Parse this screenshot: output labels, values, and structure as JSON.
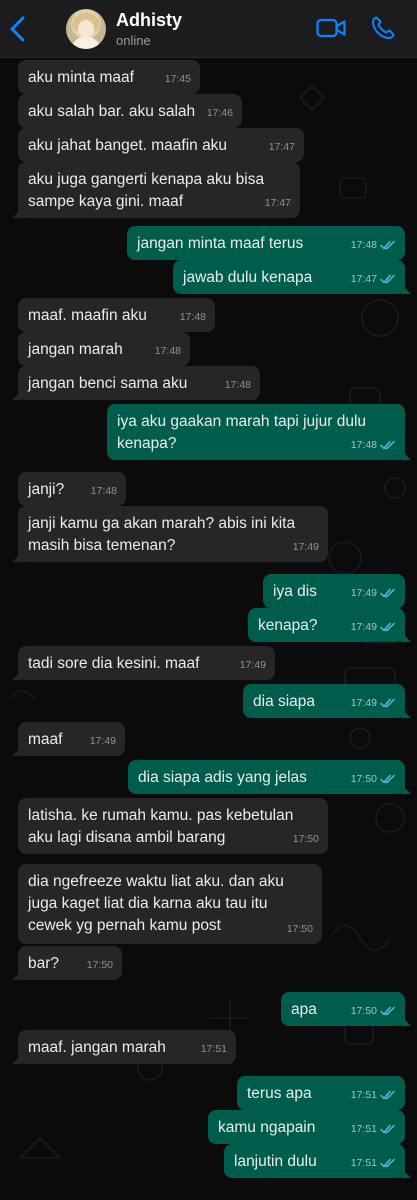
{
  "header": {
    "contact_name": "Adhisty",
    "status": "online"
  },
  "icons": {
    "back": "chevron-left-icon",
    "video": "video-call-icon",
    "call": "phone-icon",
    "read": "double-check-icon"
  },
  "colors": {
    "accent": "#0a84ff",
    "incoming_bubble": "#262628",
    "outgoing_bubble": "#005c4b",
    "read_ticks": "#53bdeb"
  },
  "messages": [
    {
      "dir": "in",
      "text": "aku minta maaf",
      "time": "17:45"
    },
    {
      "dir": "in",
      "text": "aku salah bar. aku salah",
      "time": "17:46"
    },
    {
      "dir": "in",
      "text": "aku jahat banget. maafin aku",
      "time": "17:47"
    },
    {
      "dir": "in",
      "text": "aku juga gangerti kenapa aku bisa\nsampe kaya gini. maaf",
      "time": "17:47"
    },
    {
      "dir": "out",
      "text": "jangan minta maaf terus",
      "time": "17:48",
      "read": true
    },
    {
      "dir": "out",
      "text": "jawab dulu kenapa",
      "time": "17:47",
      "read": true
    },
    {
      "dir": "in",
      "text": "maaf. maafin aku",
      "time": "17:48"
    },
    {
      "dir": "in",
      "text": "jangan marah",
      "time": "17:48"
    },
    {
      "dir": "in",
      "text": "jangan benci sama aku",
      "time": "17:48"
    },
    {
      "dir": "out",
      "text": "iya aku gaakan marah tapi jujur dulu\nkenapa?",
      "time": "17:48",
      "read": true
    },
    {
      "dir": "in",
      "text": "janji?",
      "time": "17:48"
    },
    {
      "dir": "in",
      "text": "janji kamu ga akan marah? abis ini kita\nmasih bisa temenan?",
      "time": "17:49"
    },
    {
      "dir": "out",
      "text": "iya dis",
      "time": "17:49",
      "read": true
    },
    {
      "dir": "out",
      "text": "kenapa?",
      "time": "17:49",
      "read": true
    },
    {
      "dir": "in",
      "text": "tadi sore dia kesini. maaf",
      "time": "17:49"
    },
    {
      "dir": "out",
      "text": "dia siapa",
      "time": "17:49",
      "read": true
    },
    {
      "dir": "in",
      "text": "maaf",
      "time": "17:49"
    },
    {
      "dir": "out",
      "text": "dia siapa adis yang jelas",
      "time": "17:50",
      "read": true
    },
    {
      "dir": "in",
      "text": "latisha. ke rumah kamu. pas kebetulan\naku lagi disana ambil barang",
      "time": "17:50"
    },
    {
      "dir": "in",
      "text": "dia ngefreeze waktu liat aku. dan aku\njuga kaget liat dia karna aku tau itu\ncewek yg pernah kamu post",
      "time": "17:50"
    },
    {
      "dir": "in",
      "text": "bar?",
      "time": "17:50"
    },
    {
      "dir": "out",
      "text": "apa",
      "time": "17:50",
      "read": true
    },
    {
      "dir": "in",
      "text": "maaf. jangan marah",
      "time": "17:51"
    },
    {
      "dir": "out",
      "text": "terus apa",
      "time": "17:51",
      "read": true
    },
    {
      "dir": "out",
      "text": "kamu ngapain",
      "time": "17:51",
      "read": true
    },
    {
      "dir": "out",
      "text": "lanjutin dulu",
      "time": "17:51",
      "read": true
    }
  ]
}
